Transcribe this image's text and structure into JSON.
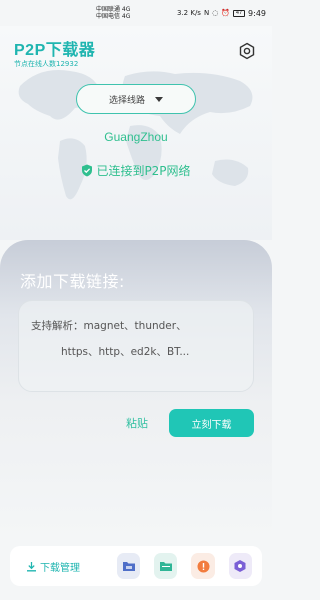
{
  "status_bar": {
    "carrier1": "中国联通 4G",
    "carrier2": "中国电信 4G",
    "speed": "3.2 K/s",
    "battery": "47",
    "time": "9:49"
  },
  "header": {
    "title": "P2P下载器",
    "node_count": "节点在线人数12932"
  },
  "route": {
    "label": "选择线路",
    "city": "GuangZhou",
    "status": "已连接到P2P网络"
  },
  "download": {
    "title": "添加下载链接:",
    "placeholder_line1": "支持解析：magnet、thunder、",
    "placeholder_line2": "https、http、ed2k、BT...",
    "paste_label": "粘贴",
    "download_label": "立刻下载"
  },
  "bottom": {
    "manage_label": "下载管理"
  },
  "colors": {
    "accent": "#1fb5b0",
    "green": "#2fbf8f",
    "button": "#20c6b6"
  },
  "icons": [
    "settings-icon",
    "caret-down-icon",
    "shield-check-icon",
    "download-arrow-icon",
    "folder-icon",
    "files-icon",
    "alert-icon",
    "hexagon-icon"
  ]
}
